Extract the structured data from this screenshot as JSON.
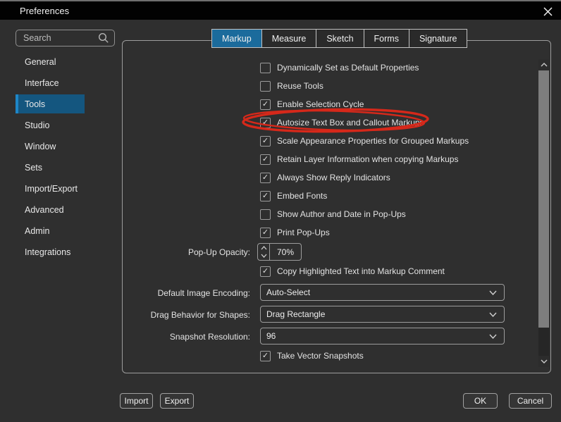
{
  "colors": {
    "accent_blue": "#1b6b9c",
    "selection_blue": "#14567f",
    "selection_stripe": "#1e86c7",
    "annotation_red": "#d6281a"
  },
  "window": {
    "title": "Preferences"
  },
  "search": {
    "placeholder": "Search",
    "icon": "magnifier"
  },
  "sidebar": {
    "items": [
      {
        "label": "General",
        "selected": false
      },
      {
        "label": "Interface",
        "selected": false
      },
      {
        "label": "Tools",
        "selected": true
      },
      {
        "label": "Studio",
        "selected": false
      },
      {
        "label": "Window",
        "selected": false
      },
      {
        "label": "Sets",
        "selected": false
      },
      {
        "label": "Import/Export",
        "selected": false
      },
      {
        "label": "Advanced",
        "selected": false
      },
      {
        "label": "Admin",
        "selected": false
      },
      {
        "label": "Integrations",
        "selected": false
      }
    ]
  },
  "tabs": [
    {
      "label": "Markup",
      "active": true
    },
    {
      "label": "Measure",
      "active": false
    },
    {
      "label": "Sketch",
      "active": false
    },
    {
      "label": "Forms",
      "active": false
    },
    {
      "label": "Signature",
      "active": false
    }
  ],
  "panel": {
    "checkboxes": [
      {
        "label": "Dynamically Set as Default Properties",
        "checked": false
      },
      {
        "label": "Reuse Tools",
        "checked": false
      },
      {
        "label": "Enable Selection Cycle",
        "checked": true
      },
      {
        "label": "Autosize Text Box and Callout Markups",
        "checked": true
      },
      {
        "label": "Scale Appearance Properties for Grouped Markups",
        "checked": true
      },
      {
        "label": "Retain Layer Information when copying Markups",
        "checked": true
      },
      {
        "label": "Always Show Reply Indicators",
        "checked": true
      },
      {
        "label": "Embed Fonts",
        "checked": true
      },
      {
        "label": "Show Author and Date in Pop-Ups",
        "checked": false
      },
      {
        "label": "Print Pop-Ups",
        "checked": true
      }
    ],
    "popup_opacity": {
      "label": "Pop-Up Opacity:",
      "value": "70%"
    },
    "copy_highlighted": {
      "label": "Copy Highlighted Text into Markup Comment",
      "checked": true
    },
    "dropdowns": [
      {
        "label": "Default Image Encoding:",
        "value": "Auto-Select"
      },
      {
        "label": "Drag Behavior for Shapes:",
        "value": "Drag Rectangle"
      },
      {
        "label": "Snapshot Resolution:",
        "value": "96"
      }
    ],
    "take_vector_snapshots": {
      "label": "Take Vector Snapshots",
      "checked": true
    }
  },
  "annotation": {
    "type": "hand-drawn-ellipse",
    "target": "Autosize Text Box and Callout Markups",
    "color": "#d6281a"
  },
  "footer": {
    "import_label": "Import",
    "export_label": "Export",
    "ok_label": "OK",
    "cancel_label": "Cancel"
  }
}
